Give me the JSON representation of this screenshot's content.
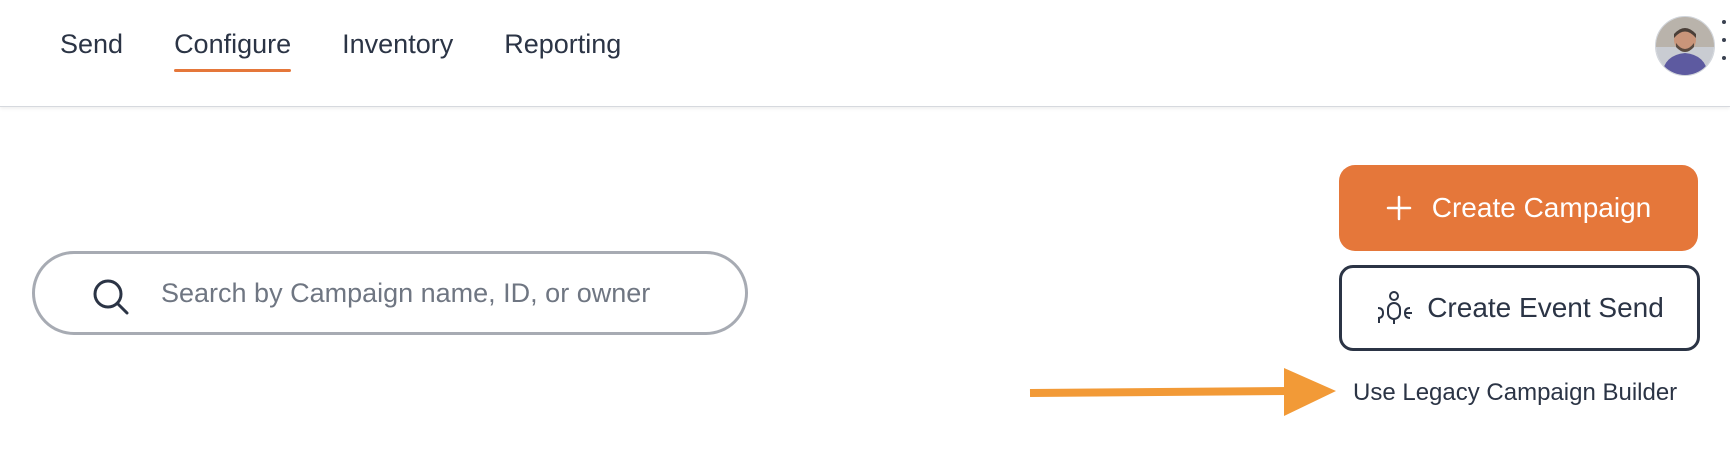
{
  "nav": {
    "tabs": [
      {
        "label": "Send",
        "active": false
      },
      {
        "label": "Configure",
        "active": true
      },
      {
        "label": "Inventory",
        "active": false
      },
      {
        "label": "Reporting",
        "active": false
      }
    ]
  },
  "user": {
    "avatar_icon": "user-avatar"
  },
  "search": {
    "placeholder": "Search by Campaign name, ID, or owner",
    "value": "",
    "icon": "search-icon"
  },
  "actions": {
    "create_campaign_label": "Create Campaign",
    "create_campaign_icon": "plus-icon",
    "create_event_send_label": "Create Event Send",
    "create_event_send_icon": "people-group-icon",
    "legacy_link_label": "Use Legacy Campaign Builder"
  },
  "annotation": {
    "arrow_icon": "arrow-right-annotation"
  },
  "colors": {
    "accent": "#e5773a",
    "text": "#2b3445",
    "annotation_arrow": "#f29a37"
  }
}
